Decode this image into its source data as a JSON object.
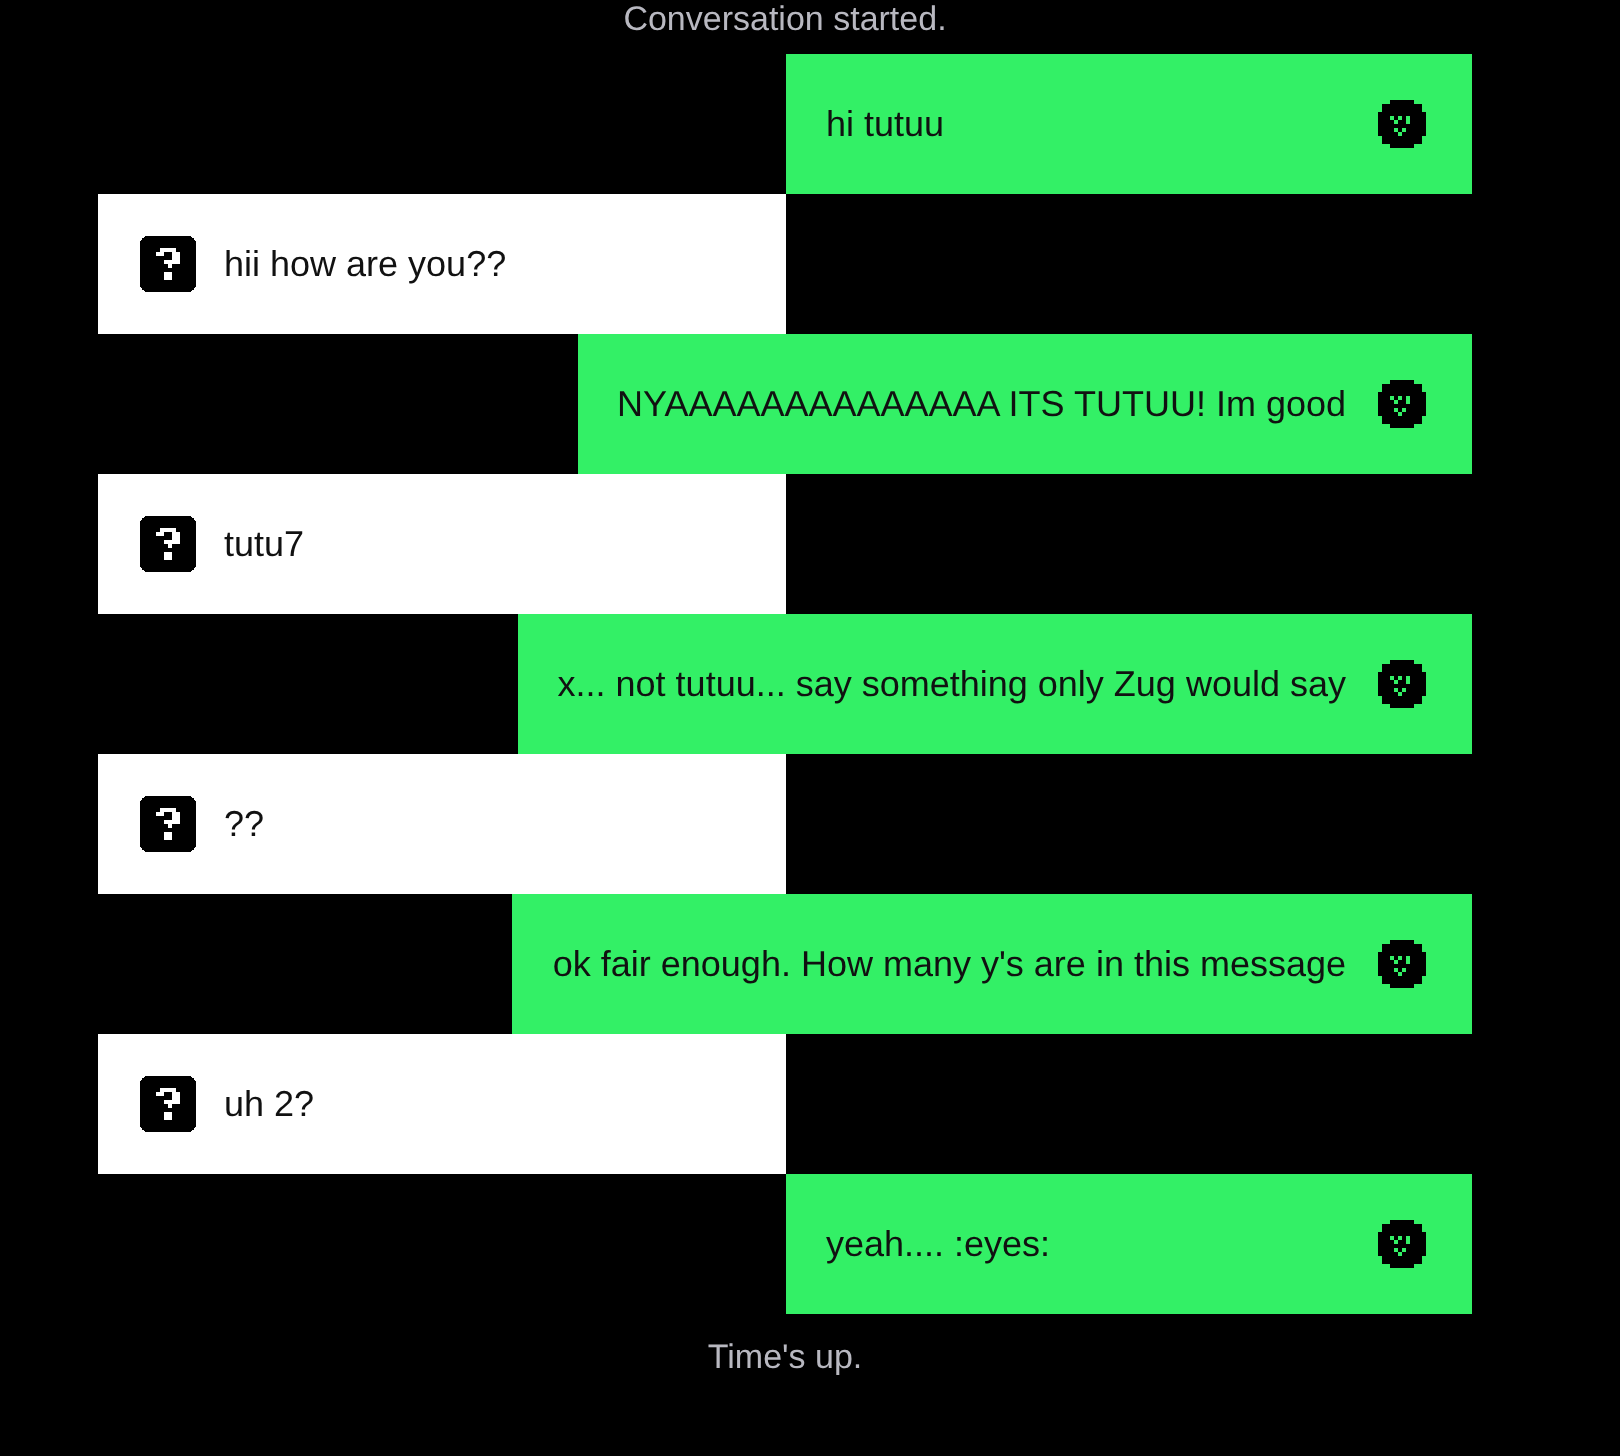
{
  "start_notice": "Conversation started.",
  "messages": [
    {
      "kind": "self",
      "text": "hi tutuu"
    },
    {
      "kind": "stranger",
      "text": "hii how are you??"
    },
    {
      "kind": "self",
      "text": "NYAAAAAAAAAAAAAA ITS TUTUU! Im good"
    },
    {
      "kind": "stranger",
      "text": "tutu7"
    },
    {
      "kind": "self",
      "text": "x... not tutuu... say something only Zug would say"
    },
    {
      "kind": "stranger",
      "text": "??"
    },
    {
      "kind": "self",
      "text": "ok fair enough. How many y's are in this message"
    },
    {
      "kind": "stranger",
      "text": "uh 2?"
    },
    {
      "kind": "self",
      "text": "yeah.... :eyes:"
    }
  ],
  "end_notice": "Time's up."
}
